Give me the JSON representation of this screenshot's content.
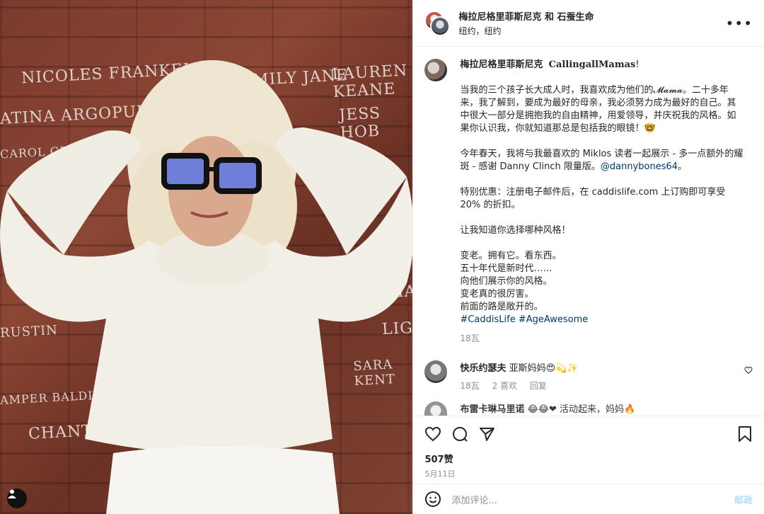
{
  "header": {
    "title": "梅拉尼格里菲斯尼克 和 石蚕生命",
    "location": "纽约，纽约",
    "more_label": "•••"
  },
  "wall_names": [
    "NICOLES FRANKEL",
    "EMILY JANE",
    "LAUREN KEANE",
    "ATINA ARGOPULO",
    "CAROL GENIE",
    "JESS HOB",
    "CHANTAL KHALIL",
    "RUSTIN",
    "AMPER BALDIN",
    "SARA KENT",
    "LIG",
    "MA"
  ],
  "caption": {
    "username": "梅拉尼格里菲斯尼克",
    "brand": "CallingallMamas",
    "excl": "!",
    "p1": "当我的三个孩子长大成人时，我喜欢成为他们的𝓜𝓪𝓶𝓪。二十多年来，我了解到，要成为最好的母亲，我必须努力成为最好的自己。其中很大一部分是拥抱我的自由精神，用爱领导，并庆祝我的风格。如果你认识我，你就知道那总是包括我的眼镜！🤓",
    "p2_a": "今年春天，我将与我最喜欢的 Miklos 读者一起展示 - 多一点额外的耀斑 - 感谢 Danny Clinch 限量版。",
    "p2_tag": "@dannybones64",
    "p2_end": "。",
    "p3": "特别优惠：注册电子邮件后，在 caddislife.com 上订购即可享受 20% 的折扣。",
    "p4": "让我知道你选择哪种风格！",
    "lines": [
      "变老。拥有它。看东西。",
      "五十年代是新时代……",
      "向他们展示你的风格。",
      "变老真的很厉害。",
      "前面的路是敞开的。"
    ],
    "hashtags": "#CaddisLife #AgeAwesome",
    "time": "18瓦"
  },
  "comments": [
    {
      "user": "快乐约瑟夫",
      "text": "亚斯妈妈😍💫✨",
      "time": "18瓦",
      "likes": "2 喜欢",
      "reply": "回复"
    },
    {
      "user": "布雷卡琳马里诺",
      "text": "😂😂❤ 活动起来，妈妈🔥"
    }
  ],
  "footer": {
    "likes": "507赞",
    "date": "5月11日",
    "add_comment_placeholder": "添加评论...",
    "post_label": "邮政"
  }
}
